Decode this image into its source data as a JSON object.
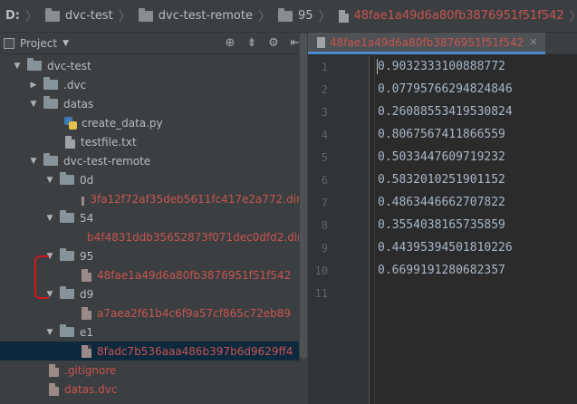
{
  "breadcrumb": {
    "items": [
      {
        "label": "D:",
        "type": "drive"
      },
      {
        "label": "dvc-test",
        "type": "folder"
      },
      {
        "label": "dvc-test-remote",
        "type": "folder"
      },
      {
        "label": "95",
        "type": "folder"
      },
      {
        "label": "48fae1a49d6a80fb3876951f51f542",
        "type": "file"
      }
    ]
  },
  "project_panel": {
    "title": "Project",
    "toolbar_icons": [
      "crosshair-icon",
      "collapse-icon",
      "gear-icon",
      "hide-icon"
    ]
  },
  "tree": [
    {
      "label": "dvc-test",
      "kind": "folder",
      "expanded": true,
      "depth": 0
    },
    {
      "label": ".dvc",
      "kind": "folder",
      "expanded": false,
      "depth": 1
    },
    {
      "label": "datas",
      "kind": "folder",
      "expanded": true,
      "depth": 1
    },
    {
      "label": "create_data.py",
      "kind": "python",
      "depth": 2
    },
    {
      "label": "testfile.txt",
      "kind": "text",
      "depth": 2
    },
    {
      "label": "dvc-test-remote",
      "kind": "folder",
      "expanded": true,
      "depth": 1
    },
    {
      "label": "0d",
      "kind": "folder",
      "expanded": true,
      "depth": 2
    },
    {
      "label": "3fa12f72af35deb5611fc417e2a772.dir",
      "kind": "file",
      "red": true,
      "depth": 3
    },
    {
      "label": "54",
      "kind": "folder",
      "expanded": true,
      "depth": 2
    },
    {
      "label": "b4f4831ddb35652873f071dec0dfd2.dir",
      "kind": "file",
      "red": true,
      "depth": 3
    },
    {
      "label": "95",
      "kind": "folder",
      "expanded": true,
      "depth": 2
    },
    {
      "label": "48fae1a49d6a80fb3876951f51f542",
      "kind": "file",
      "red": true,
      "depth": 3
    },
    {
      "label": "d9",
      "kind": "folder",
      "expanded": true,
      "depth": 2
    },
    {
      "label": "a7aea2f61b4c6f9a57cf865c72eb89",
      "kind": "file",
      "red": true,
      "depth": 3
    },
    {
      "label": "e1",
      "kind": "folder",
      "expanded": true,
      "depth": 2
    },
    {
      "label": "8fadc7b536aaa486b397b6d9629ff4",
      "kind": "file",
      "red": true,
      "selected": true,
      "depth": 3
    },
    {
      "label": ".gitignore",
      "kind": "file",
      "red": true,
      "depth": 1
    },
    {
      "label": "datas.dvc",
      "kind": "file",
      "red": true,
      "depth": 1
    }
  ],
  "editor": {
    "tab_label": "48fae1a49d6a80fb3876951f51f542",
    "lines": [
      {
        "n": "1",
        "text": "0.9032333100888772"
      },
      {
        "n": "2",
        "text": "0.07795766294824846"
      },
      {
        "n": "3",
        "text": "0.26088553419530824"
      },
      {
        "n": "4",
        "text": "0.8067567411866559"
      },
      {
        "n": "5",
        "text": "0.5033447609719232"
      },
      {
        "n": "6",
        "text": "0.5832010251901152"
      },
      {
        "n": "7",
        "text": "0.4863446662707822"
      },
      {
        "n": "8",
        "text": "0.3554038165735859"
      },
      {
        "n": "9",
        "text": "0.44395394501810226"
      },
      {
        "n": "10",
        "text": "0.6699191280682357"
      },
      {
        "n": "11",
        "text": ""
      }
    ]
  },
  "colors": {
    "accent": "#4a88c7",
    "untracked_red": "#c75450",
    "annotation_red": "#d0181c"
  }
}
